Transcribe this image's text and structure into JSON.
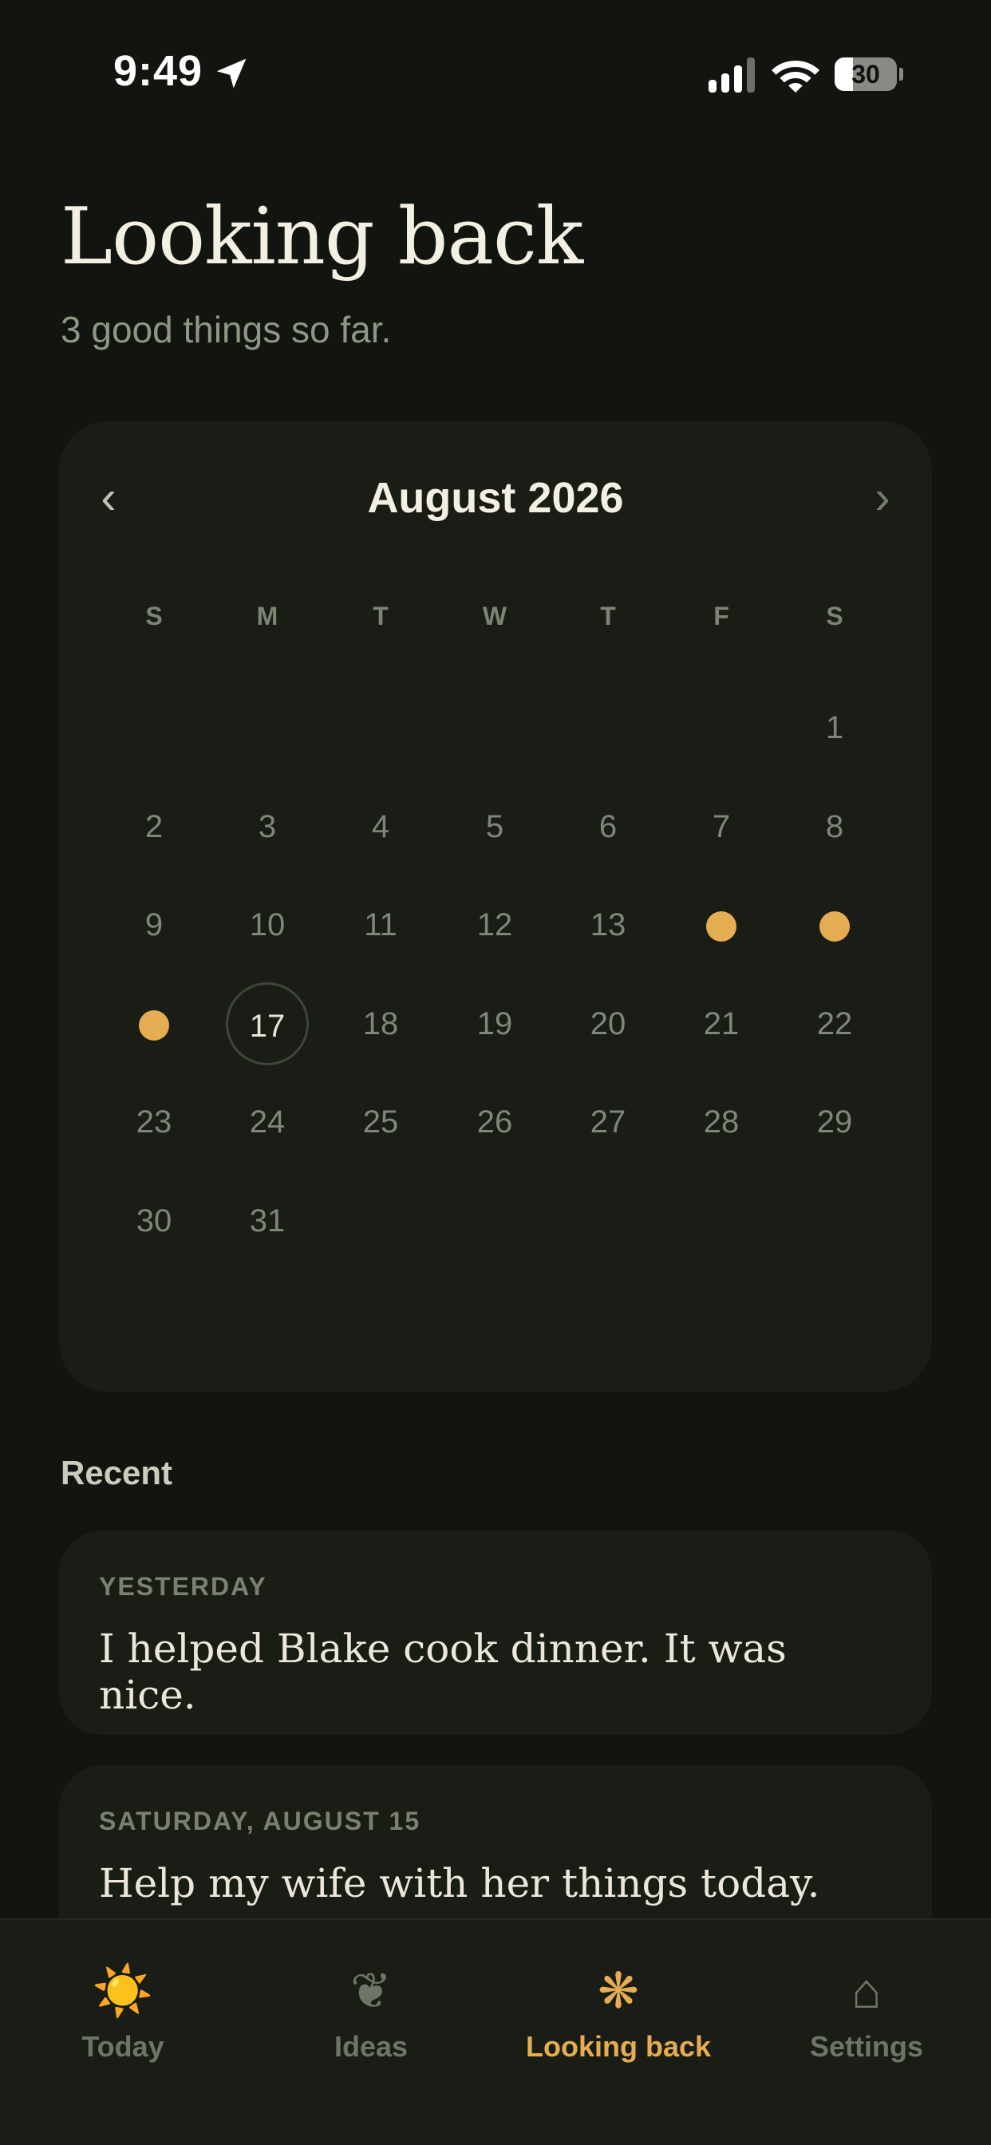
{
  "status_bar": {
    "time": "9:49",
    "battery": "30",
    "battery_fraction": 0.3
  },
  "header": {
    "title": "Looking back",
    "subtitle": "3 good things so far."
  },
  "calendar": {
    "month_label": "August 2026",
    "prev_label": "‹",
    "next_label": "›",
    "weekdays": [
      "S",
      "M",
      "T",
      "W",
      "T",
      "F",
      "S"
    ],
    "first_weekday_index": 6,
    "days_in_month": 31,
    "marked_days": [
      14,
      15,
      16
    ],
    "today": 17,
    "dot_color": "#e4ad52"
  },
  "recent": {
    "heading": "Recent",
    "entries": [
      {
        "date": "YESTERDAY",
        "text": "I helped Blake cook dinner. It was nice."
      },
      {
        "date": "SATURDAY, AUGUST 15",
        "text": "Help my wife with her things today."
      }
    ]
  },
  "tabs": [
    {
      "label": "Today",
      "icon": "sun-icon",
      "glyph": "☀️",
      "active": false
    },
    {
      "label": "Ideas",
      "icon": "heart-sprout-icon",
      "glyph": "❦",
      "active": false
    },
    {
      "label": "Looking back",
      "icon": "asterisk-flower-icon",
      "glyph": "❋",
      "active": true
    },
    {
      "label": "Settings",
      "icon": "house-icon",
      "glyph": "⌂",
      "active": false
    }
  ],
  "colors": {
    "accent": "#e4ad52",
    "background": "#121410",
    "card": "#1a1d15"
  }
}
